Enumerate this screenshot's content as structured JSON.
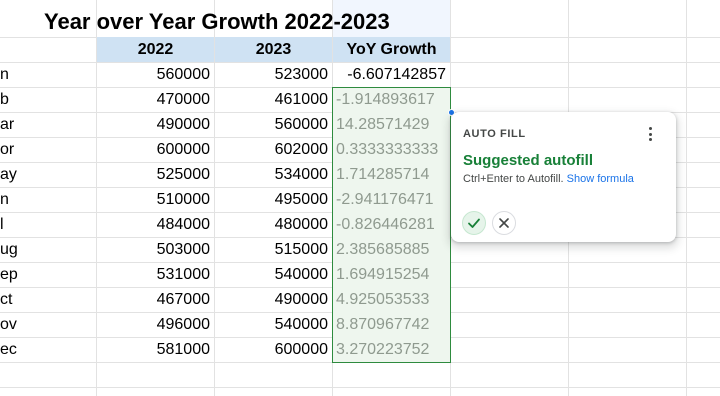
{
  "title": "Year over Year Growth 2022-2023",
  "headers": {
    "col2022": "2022",
    "col2023": "2023",
    "yoy": "YoY Growth"
  },
  "rows": [
    {
      "month": "n",
      "v2022": "560000",
      "v2023": "523000",
      "yoy": "-6.607142857"
    },
    {
      "month": "b",
      "v2022": "470000",
      "v2023": "461000",
      "yoy": "-1.914893617"
    },
    {
      "month": "ar",
      "v2022": "490000",
      "v2023": "560000",
      "yoy": "14.28571429"
    },
    {
      "month": "or",
      "v2022": "600000",
      "v2023": "602000",
      "yoy": "0.3333333333"
    },
    {
      "month": "ay",
      "v2022": "525000",
      "v2023": "534000",
      "yoy": "1.714285714"
    },
    {
      "month": "n",
      "v2022": "510000",
      "v2023": "495000",
      "yoy": "-2.941176471"
    },
    {
      "month": "l",
      "v2022": "484000",
      "v2023": "480000",
      "yoy": "-0.826446281"
    },
    {
      "month": "ug",
      "v2022": "503000",
      "v2023": "515000",
      "yoy": "2.385685885"
    },
    {
      "month": "ep",
      "v2022": "531000",
      "v2023": "540000",
      "yoy": "1.694915254"
    },
    {
      "month": "ct",
      "v2022": "467000",
      "v2023": "490000",
      "yoy": "4.925053533"
    },
    {
      "month": "ov",
      "v2022": "496000",
      "v2023": "540000",
      "yoy": "8.870967742"
    },
    {
      "month": "ec",
      "v2022": "581000",
      "v2023": "600000",
      "yoy": "3.270223752"
    }
  ],
  "autofill": {
    "header": "AUTO FILL",
    "title": "Suggested autofill",
    "subtitle": "Ctrl+Enter to Autofill.",
    "link": "Show formula",
    "accept_icon": "check-icon",
    "reject_icon": "close-icon",
    "menu_icon": "more-vert-icon"
  },
  "colors": {
    "header_bg": "#cfe2f3",
    "accent_green": "#188038",
    "link_blue": "#1a73e8",
    "suggestion_text": "#8f9a8f"
  }
}
